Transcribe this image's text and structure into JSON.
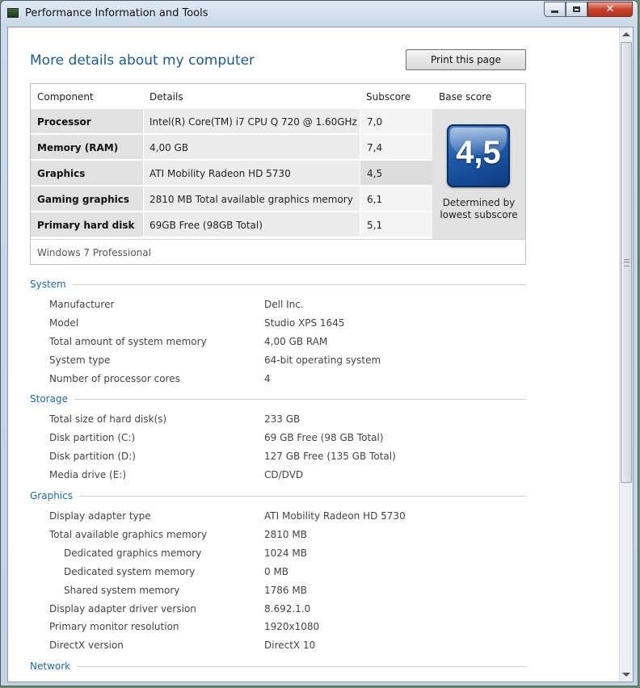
{
  "window": {
    "title": "Performance Information and Tools",
    "close_glyph": "✕"
  },
  "page": {
    "heading": "More details about my computer",
    "print_label": "Print this page"
  },
  "score_table": {
    "headers": [
      "Component",
      "Details",
      "Subscore",
      "Base score"
    ],
    "rows": [
      {
        "component": "Processor",
        "details": "Intel(R) Core(TM) i7 CPU Q 720 @ 1.60GHz",
        "subscore": "7,0"
      },
      {
        "component": "Memory (RAM)",
        "details": "4,00 GB",
        "subscore": "7,4"
      },
      {
        "component": "Graphics",
        "details": "ATI Mobility Radeon HD 5730",
        "subscore": "4,5"
      },
      {
        "component": "Gaming graphics",
        "details": "2810 MB Total available graphics memory",
        "subscore": "6,1"
      },
      {
        "component": "Primary hard disk",
        "details": "69GB Free (98GB Total)",
        "subscore": "5,1"
      }
    ],
    "base_score": "4,5",
    "base_caption_line1": "Determined by",
    "base_caption_line2": "lowest subscore",
    "edition": "Windows 7 Professional"
  },
  "sections": {
    "system": {
      "title": "System",
      "rows": [
        {
          "label": "Manufacturer",
          "value": "Dell Inc."
        },
        {
          "label": "Model",
          "value": "Studio XPS 1645"
        },
        {
          "label": "Total amount of system memory",
          "value": "4,00 GB RAM"
        },
        {
          "label": "System type",
          "value": "64-bit operating system"
        },
        {
          "label": "Number of processor cores",
          "value": "4"
        }
      ]
    },
    "storage": {
      "title": "Storage",
      "rows": [
        {
          "label": "Total size of hard disk(s)",
          "value": "233 GB"
        },
        {
          "label": "Disk partition (C:)",
          "value": "69 GB Free (98 GB Total)"
        },
        {
          "label": "Disk partition (D:)",
          "value": "127 GB Free (135 GB Total)"
        },
        {
          "label": "Media drive (E:)",
          "value": "CD/DVD"
        }
      ]
    },
    "graphics": {
      "title": "Graphics",
      "rows": [
        {
          "label": "Display adapter type",
          "value": "ATI Mobility Radeon HD 5730"
        },
        {
          "label": "Total available graphics memory",
          "value": "2810 MB"
        },
        {
          "label": "Dedicated graphics memory",
          "value": "1024 MB"
        },
        {
          "label": "Dedicated system memory",
          "value": "0 MB"
        },
        {
          "label": "Shared system memory",
          "value": "1786 MB"
        },
        {
          "label": "Display adapter driver version",
          "value": "8.692.1.0"
        },
        {
          "label": "Primary monitor resolution",
          "value": "1920x1080"
        },
        {
          "label": "DirectX version",
          "value": "DirectX 10"
        }
      ]
    },
    "network": {
      "title": "Network"
    }
  },
  "colors": {
    "heading": "#1e5a8c",
    "section_title": "#1e6aa0",
    "badge": "#1e5aa8"
  },
  "icons": [
    "app-icon",
    "minimize-icon",
    "maximize-icon",
    "close-icon",
    "scroll-up-icon",
    "scroll-down-icon"
  ]
}
